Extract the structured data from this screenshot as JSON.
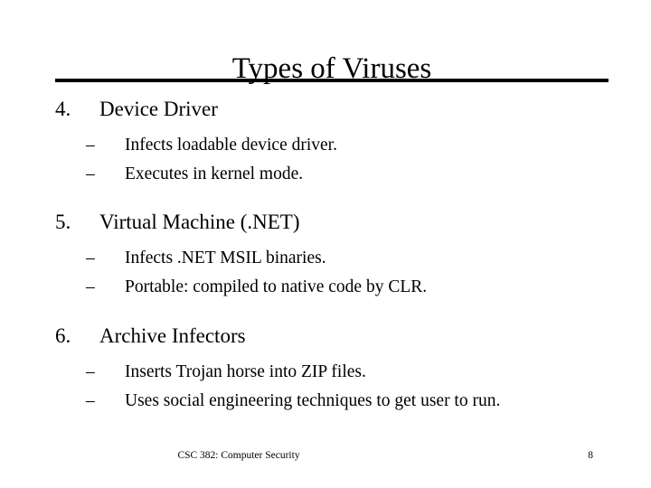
{
  "slide": {
    "title": "Types of Viruses",
    "items": [
      {
        "number": "4.",
        "title": "Device Driver",
        "bullets": [
          {
            "marker": "–",
            "text": "Infects loadable device driver."
          },
          {
            "marker": "–",
            "text": "Executes in kernel mode."
          }
        ]
      },
      {
        "number": "5.",
        "title": "Virtual Machine (.NET)",
        "bullets": [
          {
            "marker": "–",
            "text": "Infects .NET MSIL binaries."
          },
          {
            "marker": "–",
            "text": "Portable: compiled to native code by CLR."
          }
        ]
      },
      {
        "number": "6.",
        "title": "Archive Infectors",
        "bullets": [
          {
            "marker": "–",
            "text": "Inserts Trojan horse into ZIP files."
          },
          {
            "marker": "–",
            "text": "Uses social engineering techniques to get user to run."
          }
        ]
      }
    ],
    "footer": {
      "course": "CSC 382: Computer Security",
      "page_number": "8"
    },
    "colors": {
      "background": "#ffffff",
      "text": "#000000",
      "rule": "#000000"
    }
  }
}
